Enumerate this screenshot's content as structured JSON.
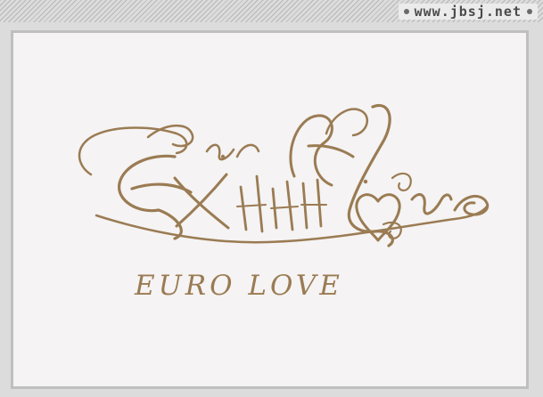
{
  "site": {
    "label": "www.jbsj.net"
  },
  "logo": {
    "caption": "EURO LOVE",
    "accent_color": "#9a7b53"
  }
}
